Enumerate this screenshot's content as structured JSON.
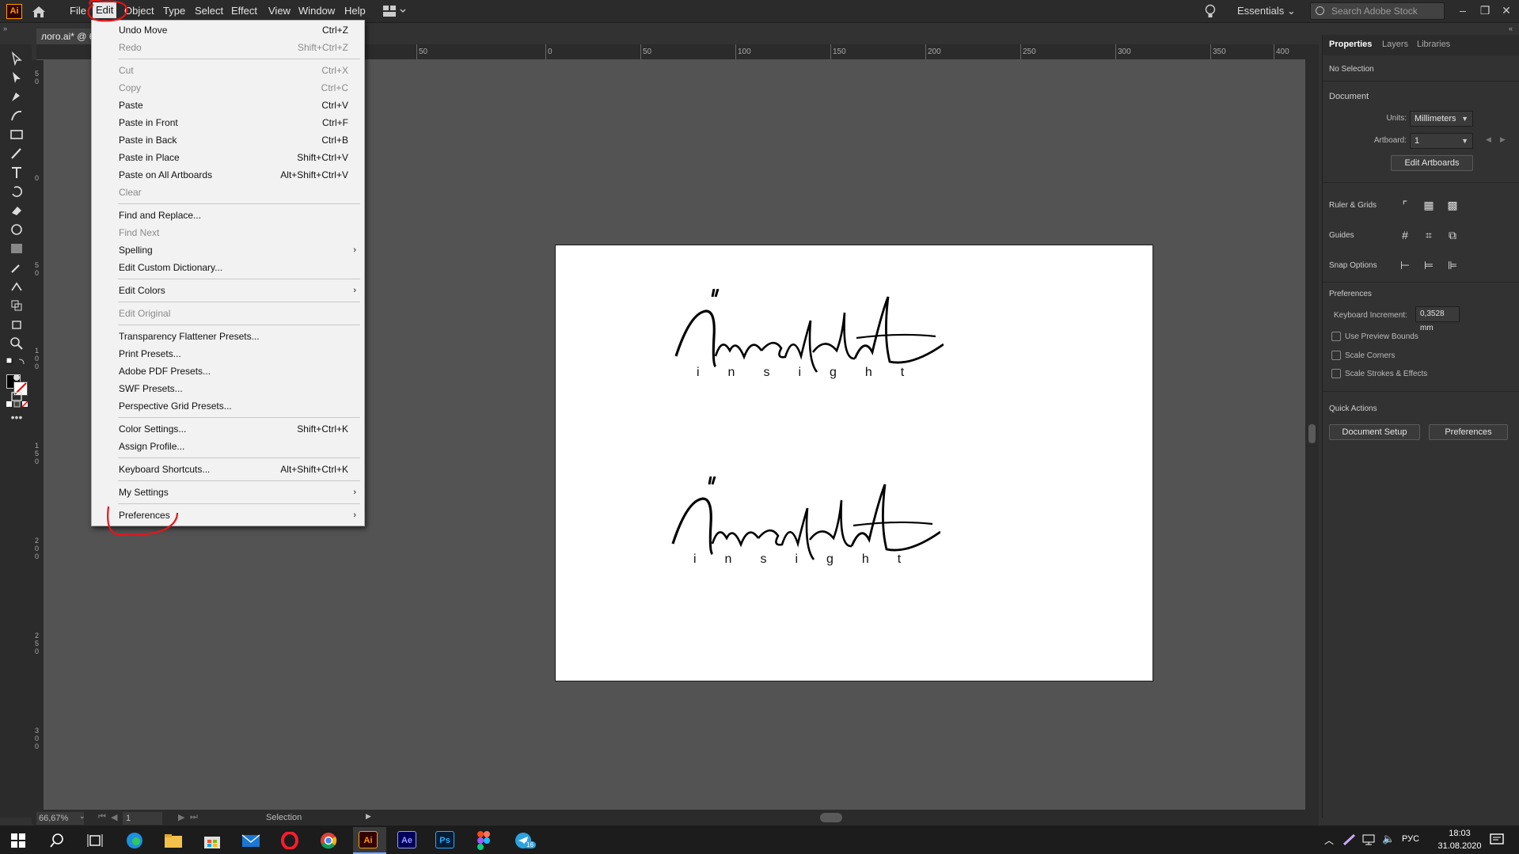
{
  "app": {
    "logo": "Ai",
    "menus": [
      "File",
      "Edit",
      "Object",
      "Type",
      "Select",
      "Effect",
      "View",
      "Window",
      "Help"
    ],
    "open_menu": "Edit",
    "workspace": "Essentials",
    "search_placeholder": "Search Adobe Stock",
    "document_tab": "лого.ai* @ 6"
  },
  "edit_menu": {
    "items": [
      {
        "label": "Undo Move",
        "shortcut": "Ctrl+Z",
        "disabled": false
      },
      {
        "label": "Redo",
        "shortcut": "Shift+Ctrl+Z",
        "disabled": true
      },
      {
        "label": "Cut",
        "shortcut": "Ctrl+X",
        "disabled": true
      },
      {
        "label": "Copy",
        "shortcut": "Ctrl+C",
        "disabled": true
      },
      {
        "label": "Paste",
        "shortcut": "Ctrl+V",
        "disabled": false
      },
      {
        "label": "Paste in Front",
        "shortcut": "Ctrl+F",
        "disabled": false
      },
      {
        "label": "Paste in Back",
        "shortcut": "Ctrl+B",
        "disabled": false
      },
      {
        "label": "Paste in Place",
        "shortcut": "Shift+Ctrl+V",
        "disabled": false
      },
      {
        "label": "Paste on All Artboards",
        "shortcut": "Alt+Shift+Ctrl+V",
        "disabled": false
      },
      {
        "label": "Clear",
        "shortcut": "",
        "disabled": true
      },
      {
        "label": "Find and Replace...",
        "shortcut": "",
        "disabled": false
      },
      {
        "label": "Find Next",
        "shortcut": "",
        "disabled": true
      },
      {
        "label": "Spelling",
        "shortcut": "",
        "disabled": false,
        "submenu": true
      },
      {
        "label": "Edit Custom Dictionary...",
        "shortcut": "",
        "disabled": false
      },
      {
        "label": "Edit Colors",
        "shortcut": "",
        "disabled": false,
        "submenu": true
      },
      {
        "label": "Edit Original",
        "shortcut": "",
        "disabled": true
      },
      {
        "label": "Transparency Flattener Presets...",
        "shortcut": "",
        "disabled": false
      },
      {
        "label": "Print Presets...",
        "shortcut": "",
        "disabled": false
      },
      {
        "label": "Adobe PDF Presets...",
        "shortcut": "",
        "disabled": false
      },
      {
        "label": "SWF Presets...",
        "shortcut": "",
        "disabled": false
      },
      {
        "label": "Perspective Grid Presets...",
        "shortcut": "",
        "disabled": false
      },
      {
        "label": "Color Settings...",
        "shortcut": "Shift+Ctrl+K",
        "disabled": false
      },
      {
        "label": "Assign Profile...",
        "shortcut": "",
        "disabled": false
      },
      {
        "label": "Keyboard Shortcuts...",
        "shortcut": "Alt+Shift+Ctrl+K",
        "disabled": false
      },
      {
        "label": "My Settings",
        "shortcut": "",
        "disabled": false,
        "submenu": true
      },
      {
        "label": "Preferences",
        "shortcut": "",
        "disabled": false,
        "submenu": true
      }
    ]
  },
  "ruler": {
    "top_ticks": [
      "50",
      "0",
      "50",
      "100",
      "150",
      "200",
      "250",
      "300",
      "350",
      "400"
    ],
    "left_ticks": [
      "5 0",
      "0",
      "5 0",
      "1 0 0",
      "1 5 0",
      "2 0 0",
      "2 5 0",
      "3 0 0"
    ]
  },
  "artboard": {
    "logo_subtext": "insight"
  },
  "properties_panel": {
    "tabs": [
      "Properties",
      "Layers",
      "Libraries"
    ],
    "selection": "No Selection",
    "document_section": "Document",
    "units_label": "Units:",
    "units_value": "Millimeters",
    "artboard_label": "Artboard:",
    "artboard_value": "1",
    "edit_artboards": "Edit Artboards",
    "ruler_grids": "Ruler & Grids",
    "guides": "Guides",
    "snap_options": "Snap Options",
    "preferences_section": "Preferences",
    "keyboard_increment_label": "Keyboard Increment:",
    "keyboard_increment_value": "0,3528 mm",
    "checkboxes": [
      "Use Preview Bounds",
      "Scale Corners",
      "Scale Strokes & Effects"
    ],
    "quick_actions": "Quick Actions",
    "document_setup": "Document Setup",
    "preferences_button": "Preferences"
  },
  "status_bar": {
    "zoom": "66,67%",
    "artboard_nav": "1",
    "tool": "Selection"
  },
  "taskbar": {
    "lang": "РУС",
    "time": "18:03",
    "date": "31.08.2020",
    "apps": [
      "Ai",
      "Ae",
      "Ps"
    ],
    "telegram_badge": "16"
  },
  "colors": {
    "annotation_red": "#e8141b",
    "ai_orange": "#ff9a00",
    "ae_purple": "#9999ff",
    "ps_blue": "#31a8ff"
  }
}
